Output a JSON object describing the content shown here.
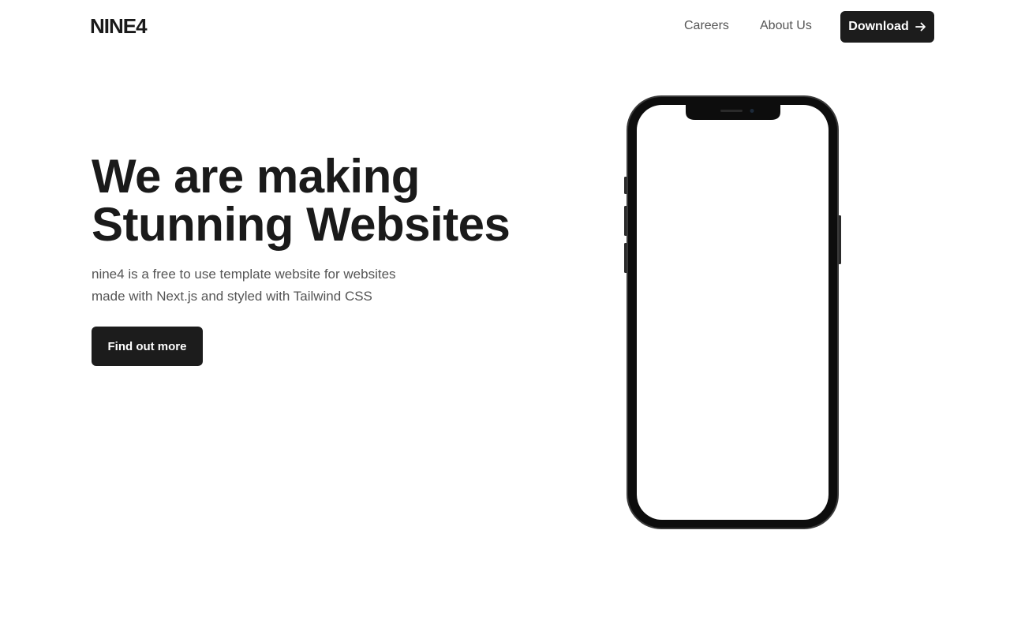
{
  "header": {
    "logo": "NINE4",
    "nav": {
      "careers": "Careers",
      "about": "About Us"
    },
    "download_label": "Download",
    "download_icon": "arrow-right-icon"
  },
  "hero": {
    "title_line1": "We are making",
    "title_line2": "Stunning Websites",
    "subtitle_line1": "nine4 is a free to use template website for websites",
    "subtitle_line2": "made with Next.js and styled with Tailwind CSS",
    "cta_label": "Find out more"
  },
  "colors": {
    "text": "#1a1a1a",
    "muted": "#555555",
    "button_bg": "#1c1c1c",
    "button_text": "#ffffff",
    "background": "#ffffff"
  }
}
